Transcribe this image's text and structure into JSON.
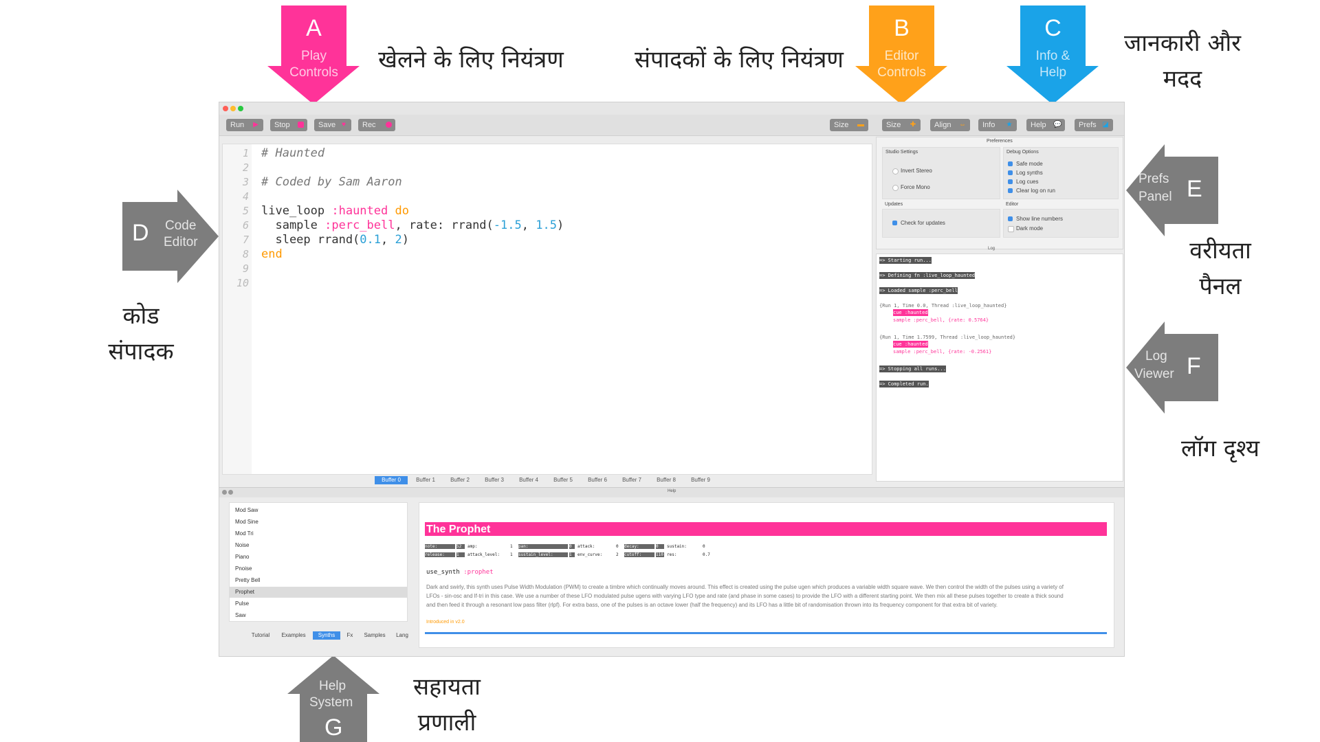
{
  "callouts": {
    "a": {
      "letter": "A",
      "label_line1": "Play",
      "label_line2": "Controls",
      "color": "#ff3399",
      "hindi": "खेलने के लिए नियंत्रण"
    },
    "b": {
      "letter": "B",
      "label_line1": "Editor",
      "label_line2": "Controls",
      "color": "#ffa11a",
      "hindi": "संपादकों के लिए नियंत्रण"
    },
    "c": {
      "letter": "C",
      "label_line1": "Info &",
      "label_line2": "Help",
      "color": "#1aa3e8",
      "hindi_line1": "जानकारी और",
      "hindi_line2": "मदद"
    },
    "d": {
      "letter": "D",
      "label_line1": "Code",
      "label_line2": "Editor",
      "color": "#7d7d7d",
      "hindi_line1": "कोड",
      "hindi_line2": "संपादक"
    },
    "e": {
      "letter": "E",
      "label_line1": "Prefs",
      "label_line2": "Panel",
      "color": "#7d7d7d",
      "hindi_line1": "वरीयता",
      "hindi_line2": "पैनल"
    },
    "f": {
      "letter": "F",
      "label_line1": "Log",
      "label_line2": "Viewer",
      "color": "#7d7d7d",
      "hindi": "लॉग दृश्य"
    },
    "g": {
      "letter": "G",
      "label_line1": "Help",
      "label_line2": "System",
      "color": "#7d7d7d",
      "hindi_line1": "सहायता",
      "hindi_line2": "प्रणाली"
    }
  },
  "toolbar": {
    "run": "Run",
    "stop": "Stop",
    "save": "Save",
    "rec": "Rec",
    "size_minus": "Size",
    "size_plus": "Size",
    "align": "Align",
    "info": "Info",
    "help": "Help",
    "prefs": "Prefs"
  },
  "editor": {
    "line_numbers": [
      "1",
      "2",
      "3",
      "4",
      "5",
      "6",
      "7",
      "8",
      "9",
      "10"
    ],
    "lines": {
      "l1": "# Haunted",
      "l3": "# Coded by Sam Aaron",
      "l5a": "live_loop ",
      "l5b": ":haunted",
      "l5c": " do",
      "l6a": "  sample ",
      "l6b": ":perc_bell",
      "l6c": ", rate: rrand(",
      "l6d": "-1.5",
      "l6e": ", ",
      "l6f": "1.5",
      "l6g": ")",
      "l7a": "  sleep rrand(",
      "l7b": "0.1",
      "l7c": ", ",
      "l7d": "2",
      "l7e": ")",
      "l8": "end"
    },
    "buffers": [
      "Buffer 0",
      "Buffer 1",
      "Buffer 2",
      "Buffer 3",
      "Buffer 4",
      "Buffer 5",
      "Buffer 6",
      "Buffer 7",
      "Buffer 8",
      "Buffer 9"
    ]
  },
  "prefs": {
    "title": "Preferences",
    "studio_settings": "Studio Settings",
    "invert_stereo": "Invert Stereo",
    "force_mono": "Force Mono",
    "debug_options": "Debug Options",
    "safe_mode": "Safe mode",
    "log_synths": "Log synths",
    "log_cues": "Log cues",
    "clear_log": "Clear log on run",
    "updates": "Updates",
    "check_updates": "Check for updates",
    "editor": "Editor",
    "show_line_numbers": "Show line numbers",
    "dark_mode": "Dark mode"
  },
  "log": {
    "title": "Log",
    "l1": "=> Starting run...",
    "l2": "=> Defining fn :live_loop_haunted",
    "l3": "=> Loaded sample :perc_bell",
    "l4": "{Run 1, Time 0.0, Thread :live_loop_haunted}",
    "l5": "cue :haunted",
    "l6": "sample :perc_bell, {rate: 0.5764}",
    "l7": "{Run 1, Time 1.7599, Thread :live_loop_haunted}",
    "l8": "cue :haunted",
    "l9": "sample :perc_bell, {rate: -0.2561}",
    "l10": "=> Stopping all runs...",
    "l11": "=> Completed run."
  },
  "help": {
    "title": "Help",
    "synths": [
      "Mod Saw",
      "Mod Sine",
      "Mod Tri",
      "Noise",
      "Piano",
      "Pnoise",
      "Pretty Bell",
      "Prophet",
      "Pulse",
      "Saw"
    ],
    "tabs": [
      "Tutorial",
      "Examples",
      "Synths",
      "Fx",
      "Samples",
      "Lang"
    ],
    "doc_title": "The Prophet",
    "use_synth": "use_synth",
    "synth_name": ":prophet",
    "description": "Dark and swirly, this synth uses Pulse Width Modulation (PWM) to create a timbre which continually moves around. This effect is created using the pulse ugen which produces a variable width square wave. We then control the width of the pulses using a variety of LFOs - sin-osc and lf-tri in this case. We use a number of these LFO modulated pulse ugens with varying LFO type and rate (and phase in some cases) to provide the LFO with a different starting point. We then mix all these pulses together to create a thick sound and then feed it through a resonant low pass filter (rlpf). For extra bass, one of the pulses is an octave lower (half the frequency) and its LFO has a little bit of randomisation thrown into its frequency component for that extra bit of variety.",
    "introduced": "Introduced in v2.0",
    "params_row1": [
      "note:",
      "52",
      "amp:",
      "1",
      "pan:",
      "0",
      "attack:",
      "0",
      "decay:",
      "0",
      "sustain:",
      "0"
    ],
    "params_row2": [
      "release:",
      "1",
      "attack_level:",
      "1",
      "sustain_level:",
      "1",
      "env_curve:",
      "2",
      "cutoff:",
      "110",
      "res:",
      "0.7"
    ]
  },
  "colors": {
    "pink": "#ff3399",
    "blue_accent": "#3f8fe8",
    "code_pink": "#ff3399",
    "code_blue": "#2a9fd6"
  }
}
